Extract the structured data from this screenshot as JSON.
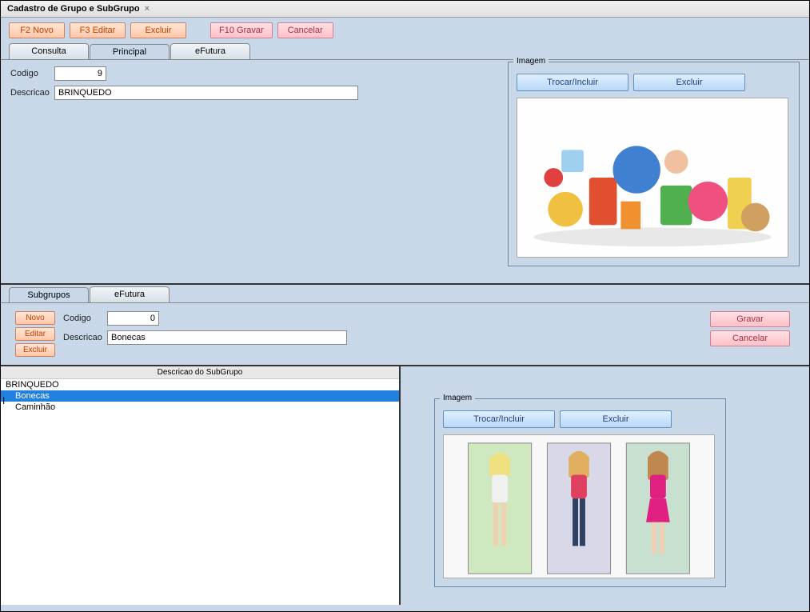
{
  "window": {
    "title": "Cadastro de Grupo e SubGrupo"
  },
  "toolbar": {
    "novo": "F2 Novo",
    "editar": "F3 Editar",
    "excluir": "Excluir",
    "gravar": "F10 Gravar",
    "cancelar": "Cancelar"
  },
  "main_tabs": {
    "consulta": "Consulta",
    "principal": "Principal",
    "efutura": "eFutura"
  },
  "grupo": {
    "codigo_label": "Codigo",
    "codigo_value": "9",
    "descricao_label": "Descricao",
    "descricao_value": "BRINQUEDO"
  },
  "imagem": {
    "group_label": "Imagem",
    "trocar": "Trocar/Incluir",
    "excluir": "Excluir"
  },
  "sub_tabs": {
    "subgrupos": "Subgrupos",
    "efutura": "eFutura"
  },
  "sub_buttons": {
    "novo": "Novo",
    "editar": "Editar",
    "excluir": "Excluir",
    "gravar": "Gravar",
    "cancelar": "Cancelar"
  },
  "subgrupo_form": {
    "codigo_label": "Codigo",
    "codigo_value": "0",
    "descricao_label": "Descricao",
    "descricao_value": "Bonecas"
  },
  "subgrupo_list": {
    "header": "Descricao do SubGrupo",
    "items": [
      {
        "label": "BRINQUEDO",
        "selected": false,
        "indent": false
      },
      {
        "label": "Bonecas",
        "selected": true,
        "indent": true
      },
      {
        "label": "Caminhão",
        "selected": false,
        "indent": true
      }
    ]
  }
}
